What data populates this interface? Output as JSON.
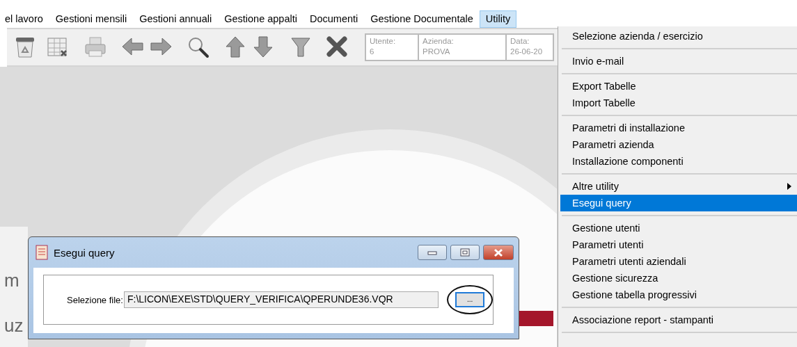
{
  "menu_bar": {
    "items": [
      {
        "label": "el lavoro",
        "selected": false
      },
      {
        "label": "Gestioni mensili",
        "selected": false
      },
      {
        "label": "Gestioni annuali",
        "selected": false
      },
      {
        "label": "Gestione appalti",
        "selected": false
      },
      {
        "label": "Documenti",
        "selected": false
      },
      {
        "label": "Gestione Documentale",
        "selected": false
      },
      {
        "label": "Utility",
        "selected": true
      }
    ]
  },
  "info_boxes": [
    {
      "label": "Utente:",
      "value": "6"
    },
    {
      "label": "Azienda:",
      "value": "PROVA"
    },
    {
      "label": "Data:",
      "value": "26-06-20"
    }
  ],
  "background_texts": [
    "m",
    "uz"
  ],
  "dropdown": {
    "groups": [
      [
        {
          "label": "Selezione azienda / esercizio",
          "selected": false,
          "submenu": false
        }
      ],
      [
        {
          "label": "Invio e-mail",
          "selected": false,
          "submenu": false
        }
      ],
      [
        {
          "label": "Export Tabelle",
          "selected": false,
          "submenu": false
        },
        {
          "label": "Import Tabelle",
          "selected": false,
          "submenu": false
        }
      ],
      [
        {
          "label": "Parametri di installazione",
          "selected": false,
          "submenu": false
        },
        {
          "label": "Parametri azienda",
          "selected": false,
          "submenu": false
        },
        {
          "label": "Installazione componenti",
          "selected": false,
          "submenu": false
        }
      ],
      [
        {
          "label": "Altre utility",
          "selected": false,
          "submenu": true
        },
        {
          "label": "Esegui query",
          "selected": true,
          "submenu": false
        }
      ],
      [
        {
          "label": "Gestione utenti",
          "selected": false,
          "submenu": false
        },
        {
          "label": "Parametri utenti",
          "selected": false,
          "submenu": false
        },
        {
          "label": "Parametri utenti aziendali",
          "selected": false,
          "submenu": false
        },
        {
          "label": "Gestione sicurezza",
          "selected": false,
          "submenu": false
        },
        {
          "label": "Gestione tabella progressivi",
          "selected": false,
          "submenu": false
        }
      ],
      [
        {
          "label": "Associazione report - stampanti",
          "selected": false,
          "submenu": false
        }
      ]
    ]
  },
  "dialog": {
    "title": "Esegui query",
    "field_label": "Selezione file:",
    "field_value": "F:\\LICON\\EXE\\STD\\QUERY_VERIFICA\\QPERUNDE36.VQR",
    "browse_label": "...",
    "browse_circled": true
  }
}
